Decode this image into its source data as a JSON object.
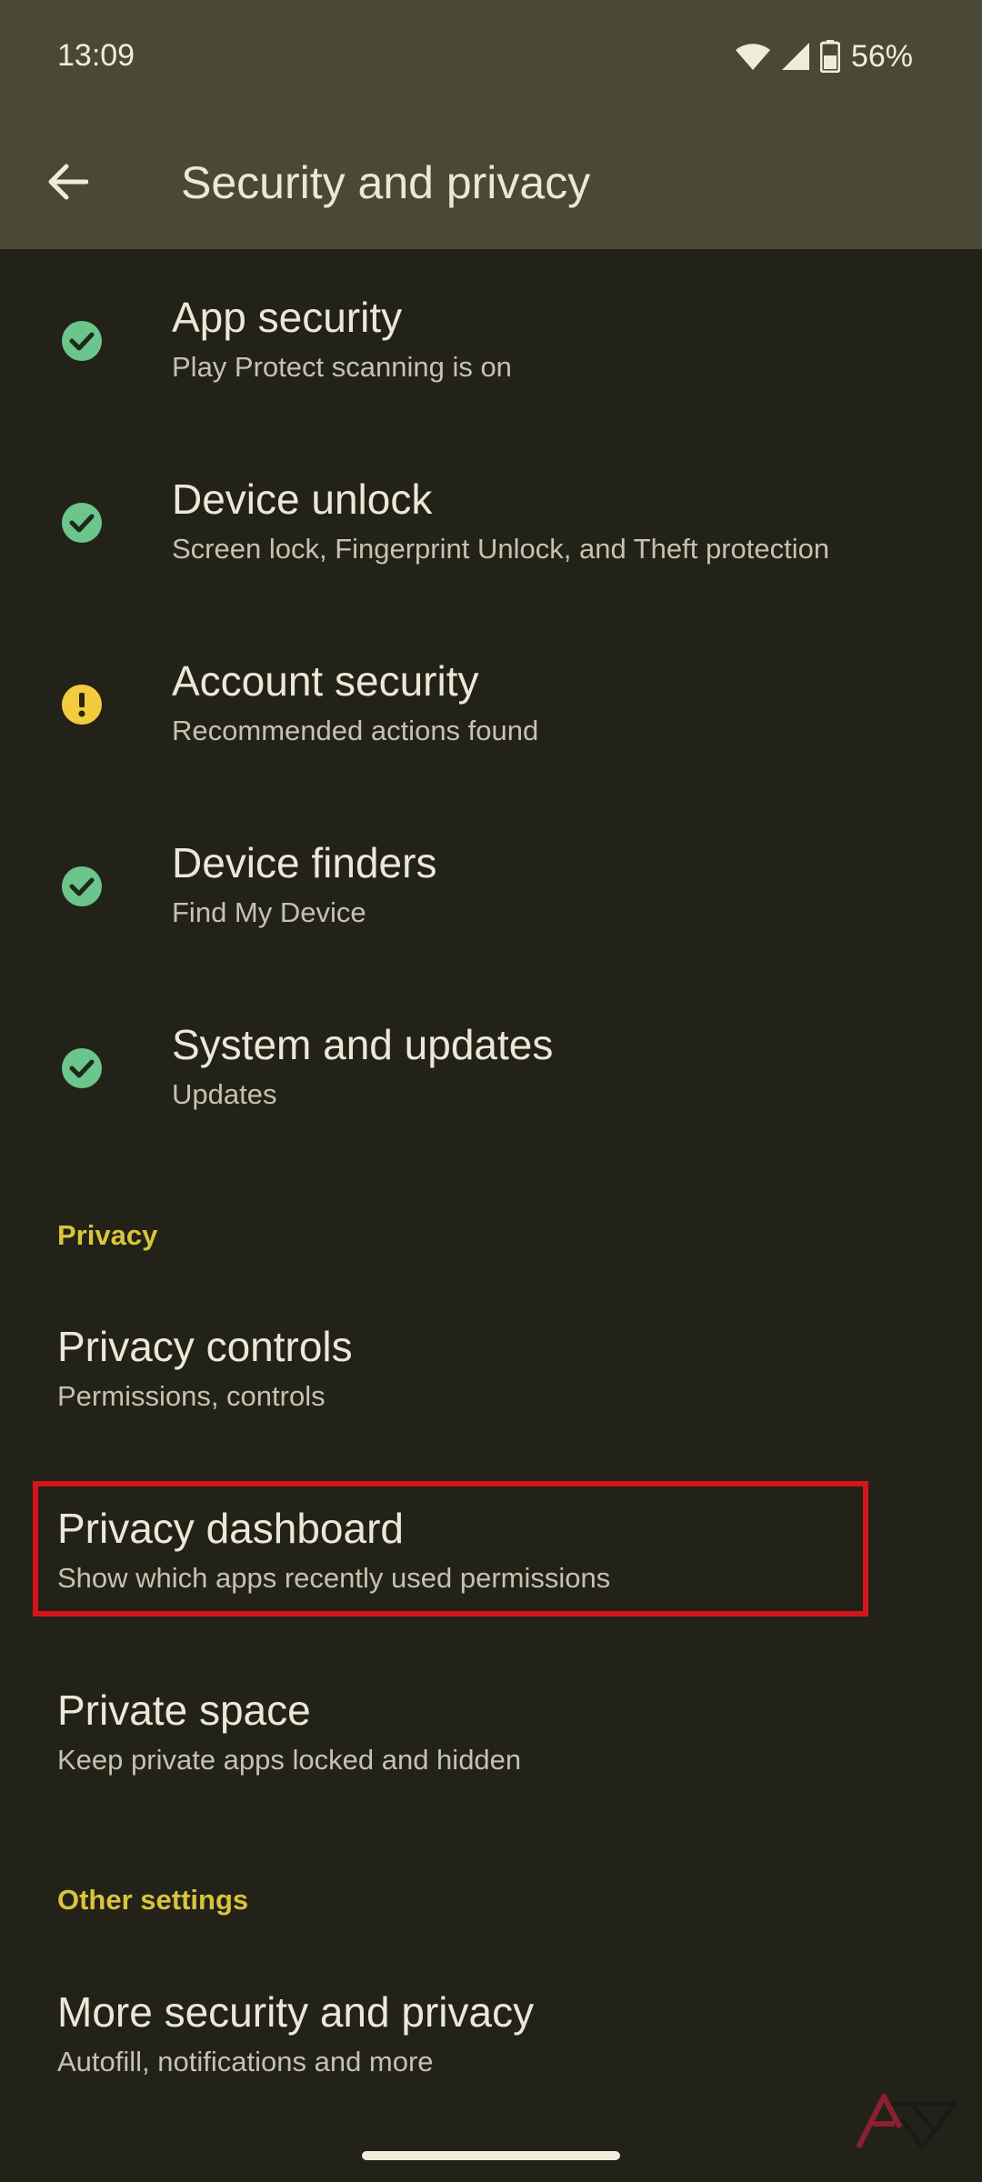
{
  "status_bar": {
    "time": "13:09",
    "battery": "56%",
    "icons": [
      "wifi-icon",
      "cell-signal-icon",
      "battery-icon"
    ]
  },
  "header": {
    "back_icon": "arrow-back-icon",
    "title": "Security and privacy"
  },
  "security_items": [
    {
      "title": "App security",
      "subtitle": "Play Protect scanning is on",
      "status": "ok",
      "icon": "check-circle-icon"
    },
    {
      "title": "Device unlock",
      "subtitle": "Screen lock, Fingerprint Unlock, and Theft protection",
      "status": "ok",
      "icon": "check-circle-icon"
    },
    {
      "title": "Account security",
      "subtitle": "Recommended actions found",
      "status": "warning",
      "icon": "warning-circle-icon"
    },
    {
      "title": "Device finders",
      "subtitle": "Find My Device",
      "status": "ok",
      "icon": "check-circle-icon"
    },
    {
      "title": "System and updates",
      "subtitle": "Updates",
      "status": "ok",
      "icon": "check-circle-icon"
    }
  ],
  "privacy_section": {
    "header": "Privacy",
    "items": [
      {
        "title": "Privacy controls",
        "subtitle": "Permissions, controls"
      },
      {
        "title": "Privacy dashboard",
        "subtitle": "Show which apps recently used permissions",
        "highlighted": true
      },
      {
        "title": "Private space",
        "subtitle": "Keep private apps locked and hidden"
      }
    ]
  },
  "other_section": {
    "header": "Other settings",
    "items": [
      {
        "title": "More security and privacy",
        "subtitle": "Autofill, notifications and more"
      }
    ]
  },
  "colors": {
    "app_bar": "#4a4936",
    "background": "#222218",
    "ok_green": "#6cc58a",
    "warning_yellow": "#f2cc3c",
    "section_accent": "#d9c43a",
    "highlight_red": "#d4151a"
  },
  "watermark": "android-police-logo"
}
